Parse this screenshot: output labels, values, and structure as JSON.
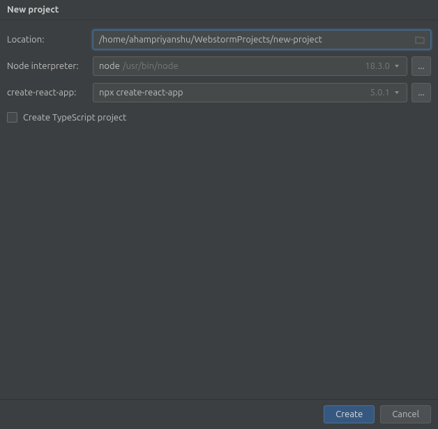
{
  "title": "New project",
  "fields": {
    "location": {
      "label": "Location:",
      "value": "/home/ahampriyanshu/WebstormProjects/new-project"
    },
    "interpreter": {
      "label": "Node interpreter:",
      "value": "node",
      "hint": "/usr/bin/node",
      "version": "18.3.0",
      "more": "..."
    },
    "cra": {
      "label": "create-react-app:",
      "value": "npx create-react-app",
      "version": "5.0.1",
      "more": "..."
    }
  },
  "checkbox": {
    "label": "Create TypeScript project"
  },
  "buttons": {
    "create": "Create",
    "cancel": "Cancel"
  }
}
